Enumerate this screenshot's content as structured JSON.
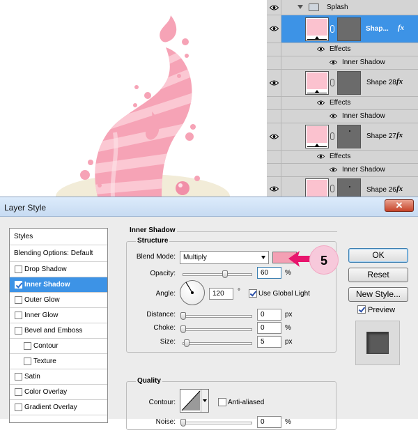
{
  "layers_panel": {
    "group": {
      "name": "Splash"
    },
    "layers": [
      {
        "name": "Shap...",
        "fx": "fx",
        "selected": true,
        "effects_label": "Effects",
        "effect": "Inner Shadow"
      },
      {
        "name": "Shape 28",
        "fx": "fx",
        "selected": false,
        "effects_label": "Effects",
        "effect": "Inner Shadow"
      },
      {
        "name": "Shape 27",
        "fx": "fx",
        "selected": false,
        "effects_label": "Effects",
        "effect": "Inner Shadow"
      },
      {
        "name": "Shape 26",
        "fx": "fx",
        "selected": false
      }
    ]
  },
  "dialog": {
    "title": "Layer Style",
    "close_label": "✕",
    "styles_list": {
      "header": "Styles",
      "blending": "Blending Options: Default",
      "items": [
        {
          "label": "Drop Shadow",
          "checked": false,
          "indent": false
        },
        {
          "label": "Inner Shadow",
          "checked": true,
          "indent": false,
          "active": true
        },
        {
          "label": "Outer Glow",
          "checked": false,
          "indent": false
        },
        {
          "label": "Inner Glow",
          "checked": false,
          "indent": false
        },
        {
          "label": "Bevel and Emboss",
          "checked": false,
          "indent": false
        },
        {
          "label": "Contour",
          "checked": false,
          "indent": true
        },
        {
          "label": "Texture",
          "checked": false,
          "indent": true
        },
        {
          "label": "Satin",
          "checked": false,
          "indent": false
        },
        {
          "label": "Color Overlay",
          "checked": false,
          "indent": false
        },
        {
          "label": "Gradient Overlay",
          "checked": false,
          "indent": false
        }
      ]
    },
    "panel_title": "Inner Shadow",
    "structure": {
      "title": "Structure",
      "blend_mode_label": "Blend Mode:",
      "blend_mode_value": "Multiply",
      "shadow_color": "#f4a0b4",
      "opacity_label": "Opacity:",
      "opacity_value": "60",
      "opacity_unit": "%",
      "opacity_level": 0.6,
      "angle_label": "Angle:",
      "angle_value": "120",
      "angle_unit": "°",
      "use_global_light_label": "Use Global Light",
      "use_global_light": true,
      "distance_label": "Distance:",
      "distance_value": "0",
      "distance_unit": "px",
      "choke_label": "Choke:",
      "choke_value": "0",
      "choke_unit": "%",
      "size_label": "Size:",
      "size_value": "5",
      "size_unit": "px"
    },
    "quality": {
      "title": "Quality",
      "contour_label": "Contour:",
      "anti_aliased_label": "Anti-aliased",
      "anti_aliased": false,
      "noise_label": "Noise:",
      "noise_value": "0",
      "noise_unit": "%"
    },
    "buttons": {
      "ok": "OK",
      "reset": "Reset",
      "new_style": "New Style...",
      "preview_label": "Preview",
      "preview": true
    },
    "callout": {
      "number": "5",
      "color": "#e8156d"
    }
  }
}
